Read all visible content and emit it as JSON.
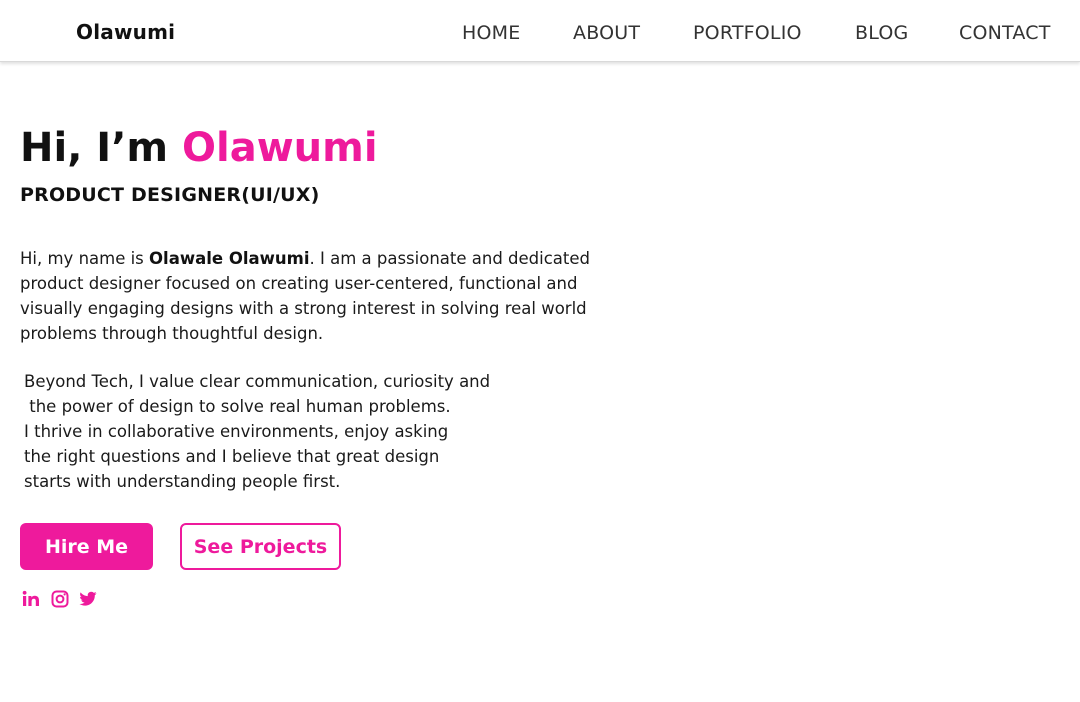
{
  "navbar": {
    "logo": "Olawumi",
    "links": [
      {
        "label": "HOME"
      },
      {
        "label": "ABOUT"
      },
      {
        "label": "PORTFOLIO"
      },
      {
        "label": "BLOG"
      },
      {
        "label": "CONTACT"
      }
    ]
  },
  "hero": {
    "greeting": "Hi, I’m ",
    "name": "Olawumi",
    "subtitle": "PRODUCT DESIGNER(UI/UX)",
    "intro": {
      "line1_prefix": "Hi, my name is ",
      "line1_bold": "Olawale Olawumi",
      "line1_suffix": ". I am a passionate and dedicated",
      "line2": "product designer focused on creating user-centered, functional and",
      "line3": "visually engaging designs with a strong interest in solving real world",
      "line4": "problems through thoughtful design."
    },
    "beyond": [
      "Beyond Tech, I value clear communication, curiosity and",
      " the power of design to solve real human problems.",
      "I thrive in collaborative environments, enjoy asking",
      "the right questions and I believe that great design",
      "starts with understanding people first."
    ]
  },
  "buttons": {
    "hire_label": "Hire Me",
    "projects_label": "See Projects"
  },
  "social": [
    {
      "icon": "linkedin-icon"
    },
    {
      "icon": "instagram-icon"
    },
    {
      "icon": "twitter-icon"
    }
  ],
  "colors": {
    "accent": "#ee1a9c",
    "text": "#111111",
    "nav_text": "#333333",
    "background": "#ffffff"
  }
}
